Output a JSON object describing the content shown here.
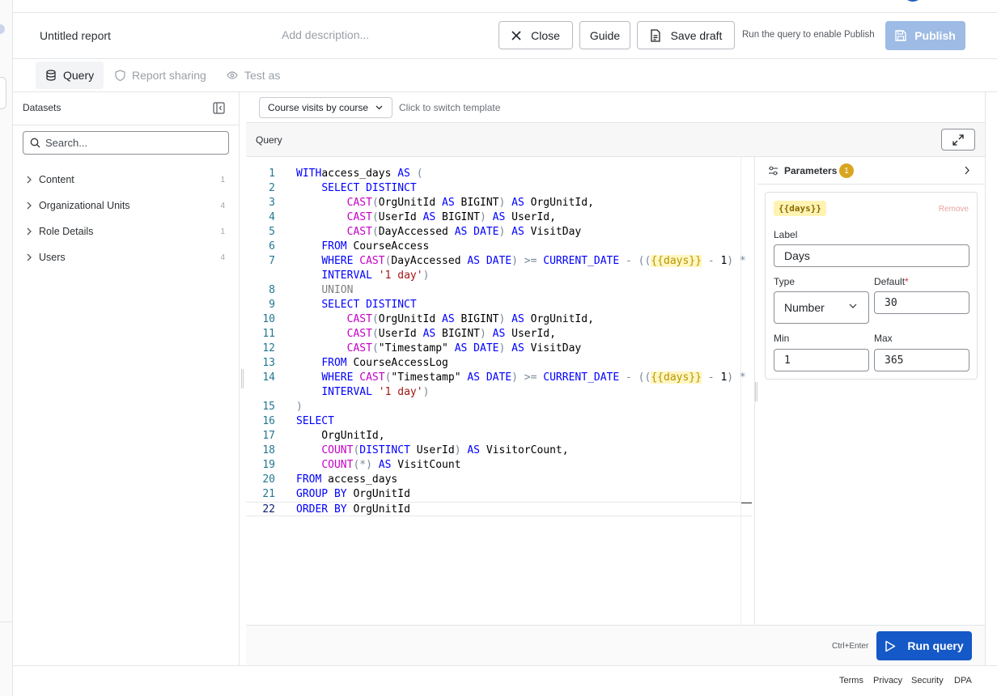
{
  "header": {
    "title": "Untitled report",
    "description_placeholder": "Add description...",
    "close_label": "Close",
    "guide_label": "Guide",
    "save_label": "Save draft",
    "publish_hint": "Run the query to enable Publish",
    "publish_label": "Publish"
  },
  "tabs": [
    {
      "label": "Query",
      "icon": "database-icon"
    },
    {
      "label": "Report sharing",
      "icon": "shield-icon"
    },
    {
      "label": "Test as",
      "icon": "eye-icon"
    }
  ],
  "sidebar": {
    "title": "Datasets",
    "search_placeholder": "Search...",
    "items": [
      {
        "label": "Content",
        "count": "1"
      },
      {
        "label": "Organizational Units",
        "count": "4"
      },
      {
        "label": "Role Details",
        "count": "1"
      },
      {
        "label": "Users",
        "count": "4"
      }
    ]
  },
  "template": {
    "selected": "Course visits by course",
    "hint": "Click to switch template"
  },
  "query": {
    "label": "Query",
    "lines": [
      [
        [
          "kw",
          "WITH"
        ],
        [
          "",
          "access_days "
        ],
        [
          "kw",
          "AS"
        ],
        [
          "op",
          " ("
        ]
      ],
      [
        [
          "",
          "    "
        ],
        [
          "kw",
          "SELECT DISTINCT"
        ]
      ],
      [
        [
          "",
          "        "
        ],
        [
          "fn",
          "CAST"
        ],
        [
          "op",
          "("
        ],
        [
          "",
          "OrgUnitId "
        ],
        [
          "kw",
          "AS"
        ],
        [
          "",
          " BIGINT"
        ],
        [
          "op",
          ")"
        ],
        [
          "",
          " "
        ],
        [
          "kw",
          "AS"
        ],
        [
          "",
          " OrgUnitId,"
        ]
      ],
      [
        [
          "",
          "        "
        ],
        [
          "fn",
          "CAST"
        ],
        [
          "op",
          "("
        ],
        [
          "",
          "UserId "
        ],
        [
          "kw",
          "AS"
        ],
        [
          "",
          " BIGINT"
        ],
        [
          "op",
          ")"
        ],
        [
          "",
          " "
        ],
        [
          "kw",
          "AS"
        ],
        [
          "",
          " UserId,"
        ]
      ],
      [
        [
          "",
          "        "
        ],
        [
          "fn",
          "CAST"
        ],
        [
          "op",
          "("
        ],
        [
          "",
          "DayAccessed "
        ],
        [
          "kw",
          "AS DATE"
        ],
        [
          "op",
          ")"
        ],
        [
          "",
          " "
        ],
        [
          "kw",
          "AS"
        ],
        [
          "",
          " VisitDay"
        ]
      ],
      [
        [
          "",
          "    "
        ],
        [
          "kw",
          "FROM"
        ],
        [
          "",
          " CourseAccess"
        ]
      ],
      [
        [
          "",
          "    "
        ],
        [
          "kw",
          "WHERE"
        ],
        [
          "",
          " "
        ],
        [
          "fn",
          "CAST"
        ],
        [
          "op",
          "("
        ],
        [
          "",
          "DayAccessed "
        ],
        [
          "kw",
          "AS DATE"
        ],
        [
          "op",
          ")"
        ],
        [
          "",
          " "
        ],
        [
          "op",
          ">="
        ],
        [
          "",
          " "
        ],
        [
          "kw",
          "CURRENT_DATE"
        ],
        [
          "",
          " "
        ],
        [
          "op",
          "- (("
        ],
        [
          "tpl",
          "{{days}}"
        ],
        [
          "",
          " "
        ],
        [
          "op",
          "- "
        ],
        [
          "",
          "1"
        ],
        [
          "op",
          ") *"
        ]
      ],
      [
        [
          "",
          "    "
        ],
        [
          "kw",
          "INTERVAL"
        ],
        [
          "",
          " "
        ],
        [
          "str",
          "'1 day'"
        ],
        [
          "op",
          ")"
        ]
      ],
      [
        [
          "",
          "    "
        ],
        [
          "gray",
          "UNION"
        ]
      ],
      [
        [
          "",
          "    "
        ],
        [
          "kw",
          "SELECT DISTINCT"
        ]
      ],
      [
        [
          "",
          "        "
        ],
        [
          "fn",
          "CAST"
        ],
        [
          "op",
          "("
        ],
        [
          "",
          "OrgUnitId "
        ],
        [
          "kw",
          "AS"
        ],
        [
          "",
          " BIGINT"
        ],
        [
          "op",
          ")"
        ],
        [
          "",
          " "
        ],
        [
          "kw",
          "AS"
        ],
        [
          "",
          " OrgUnitId,"
        ]
      ],
      [
        [
          "",
          "        "
        ],
        [
          "fn",
          "CAST"
        ],
        [
          "op",
          "("
        ],
        [
          "",
          "UserId "
        ],
        [
          "kw",
          "AS"
        ],
        [
          "",
          " BIGINT"
        ],
        [
          "op",
          ")"
        ],
        [
          "",
          " "
        ],
        [
          "kw",
          "AS"
        ],
        [
          "",
          " UserId,"
        ]
      ],
      [
        [
          "",
          "        "
        ],
        [
          "fn",
          "CAST"
        ],
        [
          "op",
          "("
        ],
        [
          "",
          "\"Timestamp\" "
        ],
        [
          "kw",
          "AS DATE"
        ],
        [
          "op",
          ")"
        ],
        [
          "",
          " "
        ],
        [
          "kw",
          "AS"
        ],
        [
          "",
          " VisitDay"
        ]
      ],
      [
        [
          "",
          "    "
        ],
        [
          "kw",
          "FROM"
        ],
        [
          "",
          " CourseAccessLog"
        ]
      ],
      [
        [
          "",
          "    "
        ],
        [
          "kw",
          "WHERE"
        ],
        [
          "",
          " "
        ],
        [
          "fn",
          "CAST"
        ],
        [
          "op",
          "("
        ],
        [
          "",
          "\"Timestamp\" "
        ],
        [
          "kw",
          "AS DATE"
        ],
        [
          "op",
          ")"
        ],
        [
          "",
          " "
        ],
        [
          "op",
          ">="
        ],
        [
          "",
          " "
        ],
        [
          "kw",
          "CURRENT_DATE"
        ],
        [
          "",
          " "
        ],
        [
          "op",
          "- (("
        ],
        [
          "tpl",
          "{{days}}"
        ],
        [
          "",
          " "
        ],
        [
          "op",
          "- "
        ],
        [
          "",
          "1"
        ],
        [
          "op",
          ") *"
        ]
      ],
      [
        [
          "",
          "    "
        ],
        [
          "kw",
          "INTERVAL"
        ],
        [
          "",
          " "
        ],
        [
          "str",
          "'1 day'"
        ],
        [
          "op",
          ")"
        ]
      ],
      [
        [
          "op",
          ")"
        ]
      ],
      [
        [
          "kw",
          "SELECT"
        ]
      ],
      [
        [
          "",
          "    OrgUnitId,"
        ]
      ],
      [
        [
          "",
          "    "
        ],
        [
          "fn",
          "COUNT"
        ],
        [
          "op",
          "("
        ],
        [
          "kw",
          "DISTINCT"
        ],
        [
          "",
          " UserId"
        ],
        [
          "op",
          ")"
        ],
        [
          "",
          " "
        ],
        [
          "kw",
          "AS"
        ],
        [
          "",
          " VisitorCount,"
        ]
      ],
      [
        [
          "",
          "    "
        ],
        [
          "fn",
          "COUNT"
        ],
        [
          "op",
          "(*)"
        ],
        [
          "",
          " "
        ],
        [
          "kw",
          "AS"
        ],
        [
          "",
          " VisitCount"
        ]
      ],
      [
        [
          "kw",
          "FROM"
        ],
        [
          "",
          " access_days"
        ]
      ],
      [
        [
          "kw",
          "GROUP BY"
        ],
        [
          "",
          " OrgUnitId"
        ]
      ],
      [
        [
          "kw",
          "ORDER BY"
        ],
        [
          "",
          " OrgUnitId"
        ]
      ]
    ],
    "line_numbers": [
      "1",
      "2",
      "3",
      "4",
      "5",
      "6",
      "7",
      "",
      "8",
      "9",
      "10",
      "11",
      "12",
      "13",
      "14",
      "",
      "15",
      "16",
      "17",
      "18",
      "19",
      "20",
      "21",
      "22"
    ]
  },
  "parameters": {
    "title": "Parameters",
    "count": "1",
    "param": {
      "token": "{{days}}",
      "remove_label": "Remove",
      "label_label": "Label",
      "label_value": "Days",
      "type_label": "Type",
      "type_value": "Number",
      "default_label": "Default",
      "default_required": "*",
      "default_value": "30",
      "min_label": "Min",
      "min_value": "1",
      "max_label": "Max",
      "max_value": "365"
    }
  },
  "run": {
    "shortcut": "Ctrl+Enter",
    "label": "Run query"
  },
  "footer": {
    "links": [
      "Terms",
      "Privacy",
      "Security",
      "DPA"
    ]
  },
  "colors": {
    "primary": "#1558c7",
    "publish_disabled": "#9dbbe4",
    "badge": "#d9a520"
  }
}
